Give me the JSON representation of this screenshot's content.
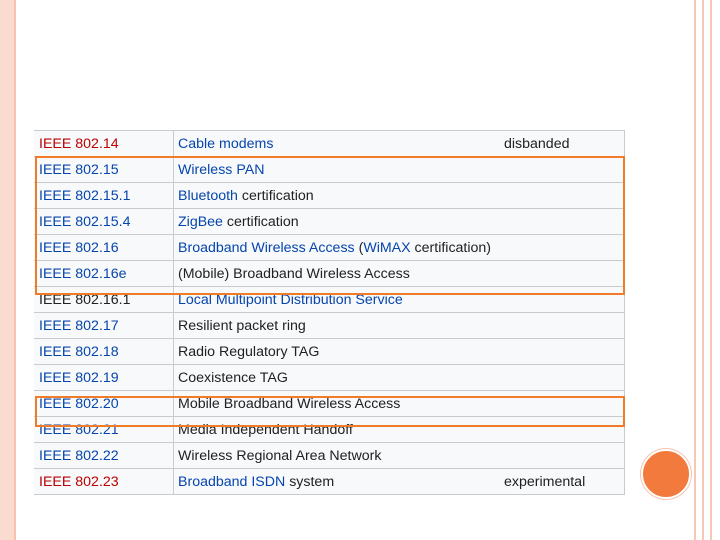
{
  "theme": {
    "accent": "#f27a3d",
    "link_blue": "#0645ad",
    "link_red": "#ba0000",
    "highlight": "#f07c2a"
  },
  "rows": [
    {
      "std": "IEEE 802.14",
      "std_style": "red",
      "desc": [
        {
          "text": "Cable modems",
          "style": "blue"
        }
      ],
      "status": "disbanded"
    },
    {
      "std": "IEEE 802.15",
      "std_style": "blue",
      "desc": [
        {
          "text": "Wireless PAN",
          "style": "blue"
        }
      ],
      "status": ""
    },
    {
      "std": "IEEE 802.15.1",
      "std_style": "blue",
      "desc": [
        {
          "text": "Bluetooth",
          "style": "blue"
        },
        {
          "text": " certification",
          "style": "plain"
        }
      ],
      "status": ""
    },
    {
      "std": "IEEE 802.15.4",
      "std_style": "blue",
      "desc": [
        {
          "text": "ZigBee",
          "style": "blue"
        },
        {
          "text": " certification",
          "style": "plain"
        }
      ],
      "status": ""
    },
    {
      "std": "IEEE 802.16",
      "std_style": "blue",
      "desc": [
        {
          "text": "Broadband Wireless Access",
          "style": "blue"
        },
        {
          "text": " (",
          "style": "plain"
        },
        {
          "text": "WiMAX",
          "style": "blue"
        },
        {
          "text": " certification)",
          "style": "plain"
        }
      ],
      "status": ""
    },
    {
      "std": "IEEE 802.16e",
      "std_style": "blue",
      "desc": [
        {
          "text": "(Mobile) Broadband Wireless Access",
          "style": "plain"
        }
      ],
      "status": ""
    },
    {
      "std": "IEEE 802.16.1",
      "std_style": "plain",
      "desc": [
        {
          "text": "Local Multipoint Distribution Service",
          "style": "blue"
        }
      ],
      "status": ""
    },
    {
      "std": "IEEE 802.17",
      "std_style": "blue",
      "desc": [
        {
          "text": "Resilient packet ring",
          "style": "plain"
        }
      ],
      "status": ""
    },
    {
      "std": "IEEE 802.18",
      "std_style": "blue",
      "desc": [
        {
          "text": "Radio Regulatory TAG",
          "style": "plain"
        }
      ],
      "status": ""
    },
    {
      "std": "IEEE 802.19",
      "std_style": "blue",
      "desc": [
        {
          "text": "Coexistence TAG",
          "style": "plain"
        }
      ],
      "status": ""
    },
    {
      "std": "IEEE 802.20",
      "std_style": "blue",
      "desc": [
        {
          "text": "Mobile Broadband Wireless Access",
          "style": "plain"
        }
      ],
      "status": ""
    },
    {
      "std": "IEEE 802.21",
      "std_style": "blue",
      "desc": [
        {
          "text": "Media Independent Handoff",
          "style": "plain"
        }
      ],
      "status": ""
    },
    {
      "std": "IEEE 802.22",
      "std_style": "blue",
      "desc": [
        {
          "text": "Wireless Regional Area Network",
          "style": "plain"
        }
      ],
      "status": ""
    },
    {
      "std": "IEEE 802.23",
      "std_style": "red",
      "desc": [
        {
          "text": "Broadband ISDN",
          "style": "blue"
        },
        {
          "text": " system",
          "style": "plain"
        }
      ],
      "status": "experimental"
    }
  ]
}
